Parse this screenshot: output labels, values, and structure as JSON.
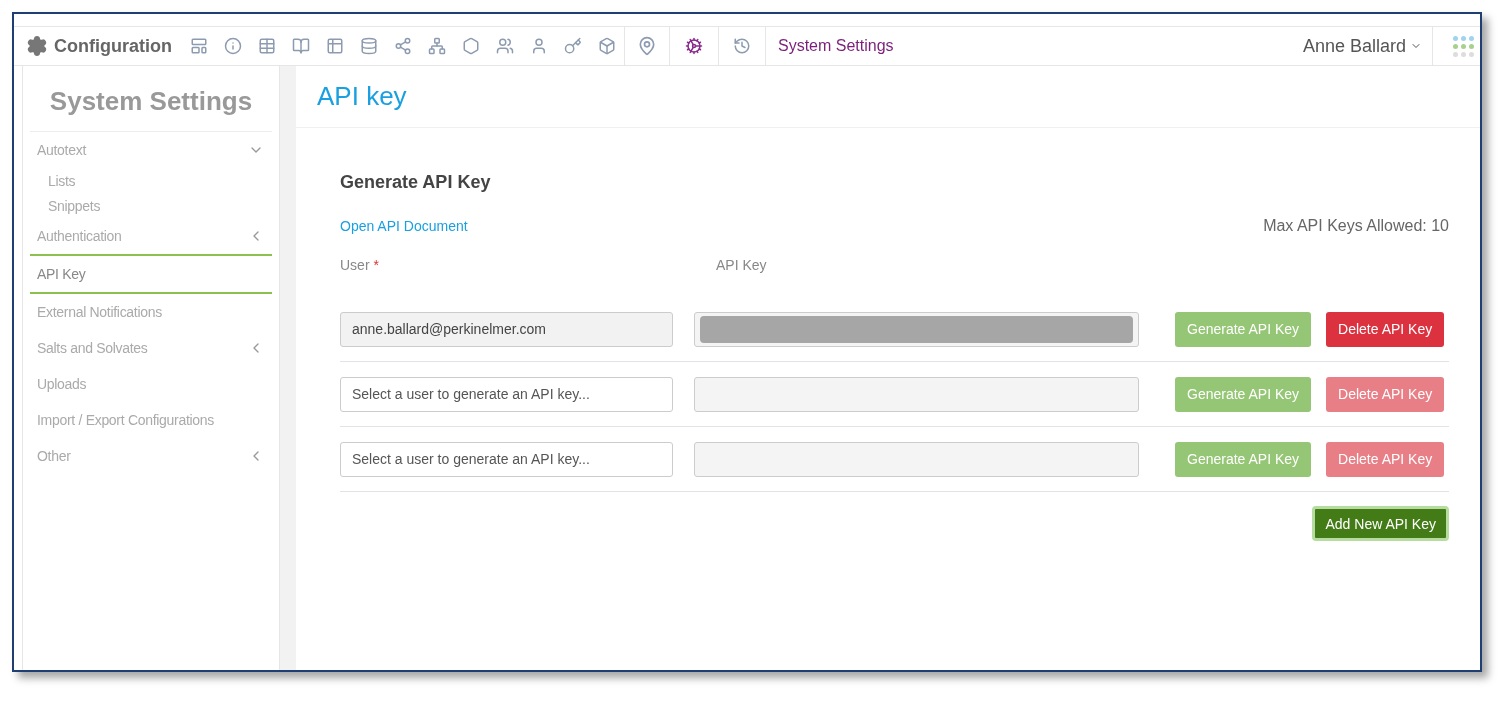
{
  "topbar": {
    "title": "Configuration",
    "breadcrumb": "System Settings",
    "user": "Anne Ballard"
  },
  "sidebar": {
    "title": "System Settings",
    "items": [
      {
        "label": "Autotext",
        "selected": false,
        "expanded": true,
        "children": [
          {
            "label": "Lists",
            "selected": false
          },
          {
            "label": "Snippets",
            "selected": false
          }
        ]
      },
      {
        "label": "Authentication",
        "selected": false,
        "expanded": false
      },
      {
        "label": "API Key",
        "selected": true
      },
      {
        "label": "External Notifications",
        "selected": false
      },
      {
        "label": "Salts and Solvates",
        "selected": false,
        "expanded": false
      },
      {
        "label": "Uploads",
        "selected": false
      },
      {
        "label": "Import / Export Configurations",
        "selected": false
      },
      {
        "label": "Other",
        "selected": false,
        "expanded": false
      }
    ]
  },
  "page_title": "API key",
  "section": {
    "title": "Generate API Key",
    "doc_link": "Open API Document",
    "max_keys": "Max API Keys Allowed: 10",
    "user_label": "User",
    "user_required": true,
    "required_mark": "*",
    "key_label": "API Key",
    "rows": [
      {
        "user_value": "anne.ballard@perkinelmer.com",
        "key_masked": true,
        "generate": "Generate API Key",
        "delete": "Delete API Key",
        "delete_disabled": false
      },
      {
        "user_placeholder": "Select a user to generate an API key...",
        "key_masked": false,
        "generate": "Generate API Key",
        "delete": "Delete API Key",
        "delete_disabled": true
      },
      {
        "user_placeholder": "Select a user to generate an API key...",
        "key_masked": false,
        "generate": "Generate API Key",
        "delete": "Delete API Key",
        "delete_disabled": true
      }
    ],
    "add_button": "Add New API Key"
  }
}
